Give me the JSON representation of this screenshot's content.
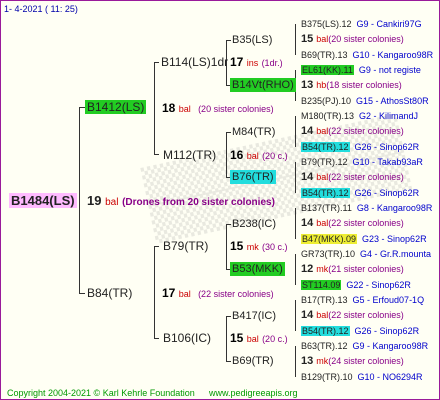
{
  "header": {
    "text": "1-  4-2021  ( 11: 25)"
  },
  "root": {
    "label": "B1484(LS)",
    "num": "19",
    "bal": "bal",
    "note": "(Drones from 20 sister colonies)"
  },
  "gen1": [
    {
      "id": "B1412(LS)",
      "num": "18",
      "bal": "bal",
      "note": "(20 sister colonies)"
    },
    {
      "id": "B84(TR)",
      "num": "17",
      "bal": "bal",
      "note": "(22 sister colonies)"
    }
  ],
  "gen2": [
    {
      "id": "B114(LS)1dr",
      "num": "17",
      "bal": "ins",
      "note": "(1dr.)"
    },
    {
      "id": "M112(TR)",
      "num": "16",
      "bal": "bal",
      "note": "(20 c.)"
    },
    {
      "id": "B79(TR)",
      "num": "15",
      "bal": "mk",
      "note": "(30 c.)"
    },
    {
      "id": "B106(IC)",
      "num": "15",
      "bal": "bal",
      "note": "(20 c.)"
    }
  ],
  "gen3": [
    {
      "id": "B35(LS)"
    },
    {
      "id": "B14Vt(RHO)"
    },
    {
      "id": "M84(TR)"
    },
    {
      "id": "B76(TR)"
    },
    {
      "id": "B238(IC)"
    },
    {
      "id": "B53(MKK)"
    },
    {
      "id": "B417(IC)"
    },
    {
      "id": "B69(TR)"
    }
  ],
  "gen4": [
    {
      "left": "B375(LS).12",
      "right": "G9 - Cankiri97G"
    },
    {
      "num": "15",
      "bal": "bal",
      "note": "(20 sister colonies)"
    },
    {
      "left": "B69(TR).13",
      "right": "G10 - Kangaroo98R"
    },
    {
      "left": "EL61(KK).11",
      "right": "G9 - not registe"
    },
    {
      "num": "13",
      "bal": "hb",
      "note": "(18 sister colonies)"
    },
    {
      "left": "B235(PJ).10",
      "right": "G15 - AthosSt80R"
    },
    {
      "left": "M180(TR).13",
      "right": "G2 - KilimandJ"
    },
    {
      "num": "14",
      "bal": "bal",
      "note": "(22 sister colonies)"
    },
    {
      "left": "B54(TR).12",
      "right": "G26 - Sinop62R"
    },
    {
      "left": "B79(TR).12",
      "right": "G10 - Takab93aR"
    },
    {
      "num": "14",
      "bal": "bal",
      "note": "(22 sister colonies)"
    },
    {
      "left": "B54(TR).12",
      "right": "G26 - Sinop62R"
    },
    {
      "left": "B137(TR).11",
      "right": "G8 - Kangaroo98R"
    },
    {
      "num": "14",
      "bal": "bal",
      "note": "(22 sister colonies)"
    },
    {
      "left": "B47(MKK).09",
      "right": "G23 - Sinop62R"
    },
    {
      "left": "GR73(TR).10",
      "right": "G4 - Gr.R.mounta"
    },
    {
      "num": "12",
      "bal": "mk",
      "note": "(21 sister colonies)"
    },
    {
      "left": "ST114.09",
      "right": "G22 - Sinop62R"
    },
    {
      "left": "B17(TR).13",
      "right": "G5 - Erfoud07-1Q"
    },
    {
      "num": "14",
      "bal": "bal",
      "note": "(22 sister colonies)"
    },
    {
      "left": "B54(TR).12",
      "right": "G26 - Sinop62R"
    },
    {
      "left": "B63(TR).12",
      "right": "G9 - Kangaroo98R"
    },
    {
      "num": "13",
      "bal": "mk",
      "note": "(24 sister colonies)"
    },
    {
      "left": "B129(TR).10",
      "right": "G10 - NO6294R"
    }
  ],
  "footer": {
    "copyright": "Copyright 2004-2021 © Karl Kehrle Foundation",
    "site": "www.pedigreeapis.org"
  },
  "colors": {
    "border": "#9a1a9a",
    "pink": "#ffbbff",
    "green": "#22cc22",
    "cyan": "#22dddd",
    "yellow": "#eeee33",
    "red": "#cc0000",
    "blue": "#0000cc",
    "purple": "#880088",
    "footer": "#009900"
  }
}
